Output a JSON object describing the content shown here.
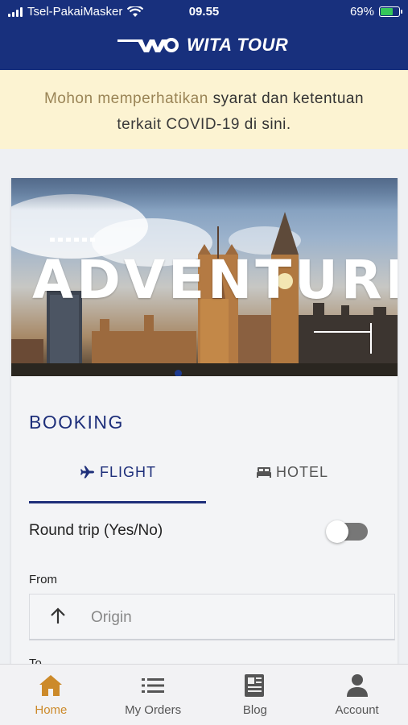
{
  "status_bar": {
    "carrier": "Tsel-PakaiMasker",
    "time": "09.55",
    "battery": "69%"
  },
  "brand": {
    "name": "WITA TOUR"
  },
  "notice": {
    "part1": "Mohon memperhatikan",
    "link1": "syarat dan ketentuan",
    "part2": "terkait COVID-19",
    "link2": "di sini."
  },
  "banner": {
    "word": "ADVENTURE"
  },
  "booking": {
    "title": "BOOKING",
    "tabs": [
      {
        "label": "FLIGHT",
        "icon": "airplane-icon",
        "active": true
      },
      {
        "label": "HOTEL",
        "icon": "bed-icon",
        "active": false
      }
    ],
    "round_trip_label": "Round trip (Yes/No)",
    "round_trip_on": false,
    "from_label": "From",
    "origin_placeholder": "Origin",
    "to_label": "To"
  },
  "nav": [
    {
      "label": "Home",
      "icon": "home-icon",
      "active": true
    },
    {
      "label": "My Orders",
      "icon": "list-icon",
      "active": false
    },
    {
      "label": "Blog",
      "icon": "newspaper-icon",
      "active": false
    },
    {
      "label": "Account",
      "icon": "person-icon",
      "active": false
    }
  ],
  "colors": {
    "header": "#18307d",
    "accent": "#1e2f7a",
    "notice_bg": "#fcf3d2",
    "active_nav": "#cc8a2a"
  }
}
